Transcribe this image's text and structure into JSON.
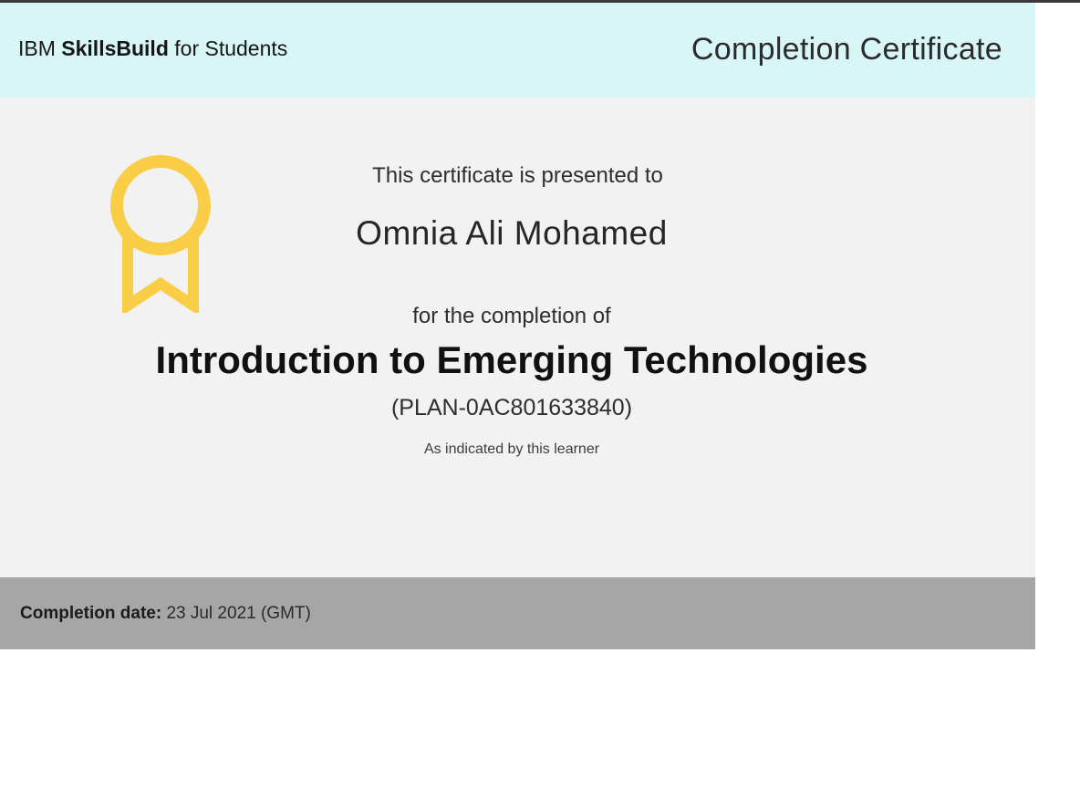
{
  "header": {
    "brand_prefix": "IBM ",
    "brand_bold": "SkillsBuild",
    "brand_suffix": " for Students",
    "title": "Completion Certificate"
  },
  "body": {
    "presented_to": "This certificate is presented to",
    "recipient_name": "Omnia Ali Mohamed",
    "completion_of": "for the completion of",
    "course_title": "Introduction to Emerging Technologies",
    "plan_id": "(PLAN-0AC801633840)",
    "indicated": "As indicated by this learner"
  },
  "footer": {
    "date_label": "Completion date:",
    "date_value": "23 Jul 2021 (GMT)"
  },
  "colors": {
    "header_bg": "#d9f6f6",
    "body_bg": "#f2f2f2",
    "footer_bg": "#a6a6a6",
    "medal": "#f9cd45"
  },
  "icons": {
    "medal": "award-ribbon-icon"
  }
}
